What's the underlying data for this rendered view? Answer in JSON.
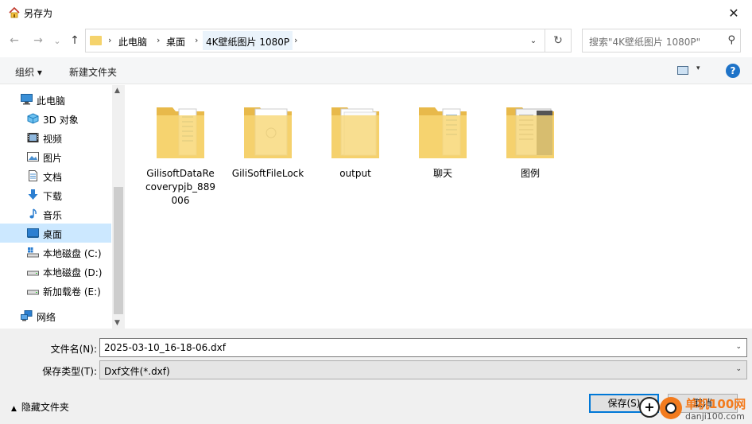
{
  "window": {
    "title": "另存为",
    "close_glyph": "✕"
  },
  "nav": {
    "back_glyph": "←",
    "forward_glyph": "→",
    "recent_glyph": "⌄",
    "up_glyph": "↑",
    "breadcrumbs": [
      "此电脑",
      "桌面",
      "4K壁纸图片 1080P"
    ],
    "crumb_sep": "›",
    "address_dropdown_glyph": "⌄",
    "refresh_glyph": "↻",
    "search_placeholder": "搜索\"4K壁纸图片 1080P\"",
    "search_glyph": "⚲"
  },
  "toolbar": {
    "organize": "组织 ▾",
    "new_folder": "新建文件夹",
    "help": "?",
    "view_dd": "▾"
  },
  "sidebar": {
    "items": [
      {
        "label": "此电脑",
        "icon": "computer-icon"
      },
      {
        "label": "3D 对象",
        "icon": "cube-icon"
      },
      {
        "label": "视频",
        "icon": "video-icon"
      },
      {
        "label": "图片",
        "icon": "picture-icon"
      },
      {
        "label": "文档",
        "icon": "document-icon"
      },
      {
        "label": "下载",
        "icon": "download-icon"
      },
      {
        "label": "音乐",
        "icon": "music-icon"
      },
      {
        "label": "桌面",
        "icon": "desktop-icon"
      },
      {
        "label": "本地磁盘 (C:)",
        "icon": "drive-icon"
      },
      {
        "label": "本地磁盘 (D:)",
        "icon": "drive-icon"
      },
      {
        "label": "新加载卷 (E:)",
        "icon": "drive-icon"
      },
      {
        "label": "网络",
        "icon": "network-icon"
      }
    ],
    "active": "桌面",
    "scroll_up": "▲",
    "scroll_down": "▼"
  },
  "files": [
    {
      "name": "GilisoftDataRecoverypjb_889006",
      "icon": "folder-icon"
    },
    {
      "name": "GiliSoftFileLock",
      "icon": "folder-icon"
    },
    {
      "name": "output",
      "icon": "folder-icon"
    },
    {
      "name": "聊天",
      "icon": "folder-icon"
    },
    {
      "name": "图例",
      "icon": "folder-icon"
    }
  ],
  "form": {
    "filename_label": "文件名(N):",
    "filename_value": "2025-03-10_16-18-06.dxf",
    "filetype_label": "保存类型(T):",
    "filetype_value": "Dxf文件(*.dxf)",
    "arrow_glyph": "⌄"
  },
  "footer": {
    "hide_folders": "隐藏文件夹",
    "hide_chevron": "▲",
    "save": "保存(S)",
    "cancel": "取消"
  },
  "watermark": {
    "line1": "单机100网",
    "line2": "danji100.com",
    "plus": "+"
  },
  "colors": {
    "accent": "#0078d7",
    "selection": "#cce8ff",
    "folder": "#f5d36c"
  }
}
